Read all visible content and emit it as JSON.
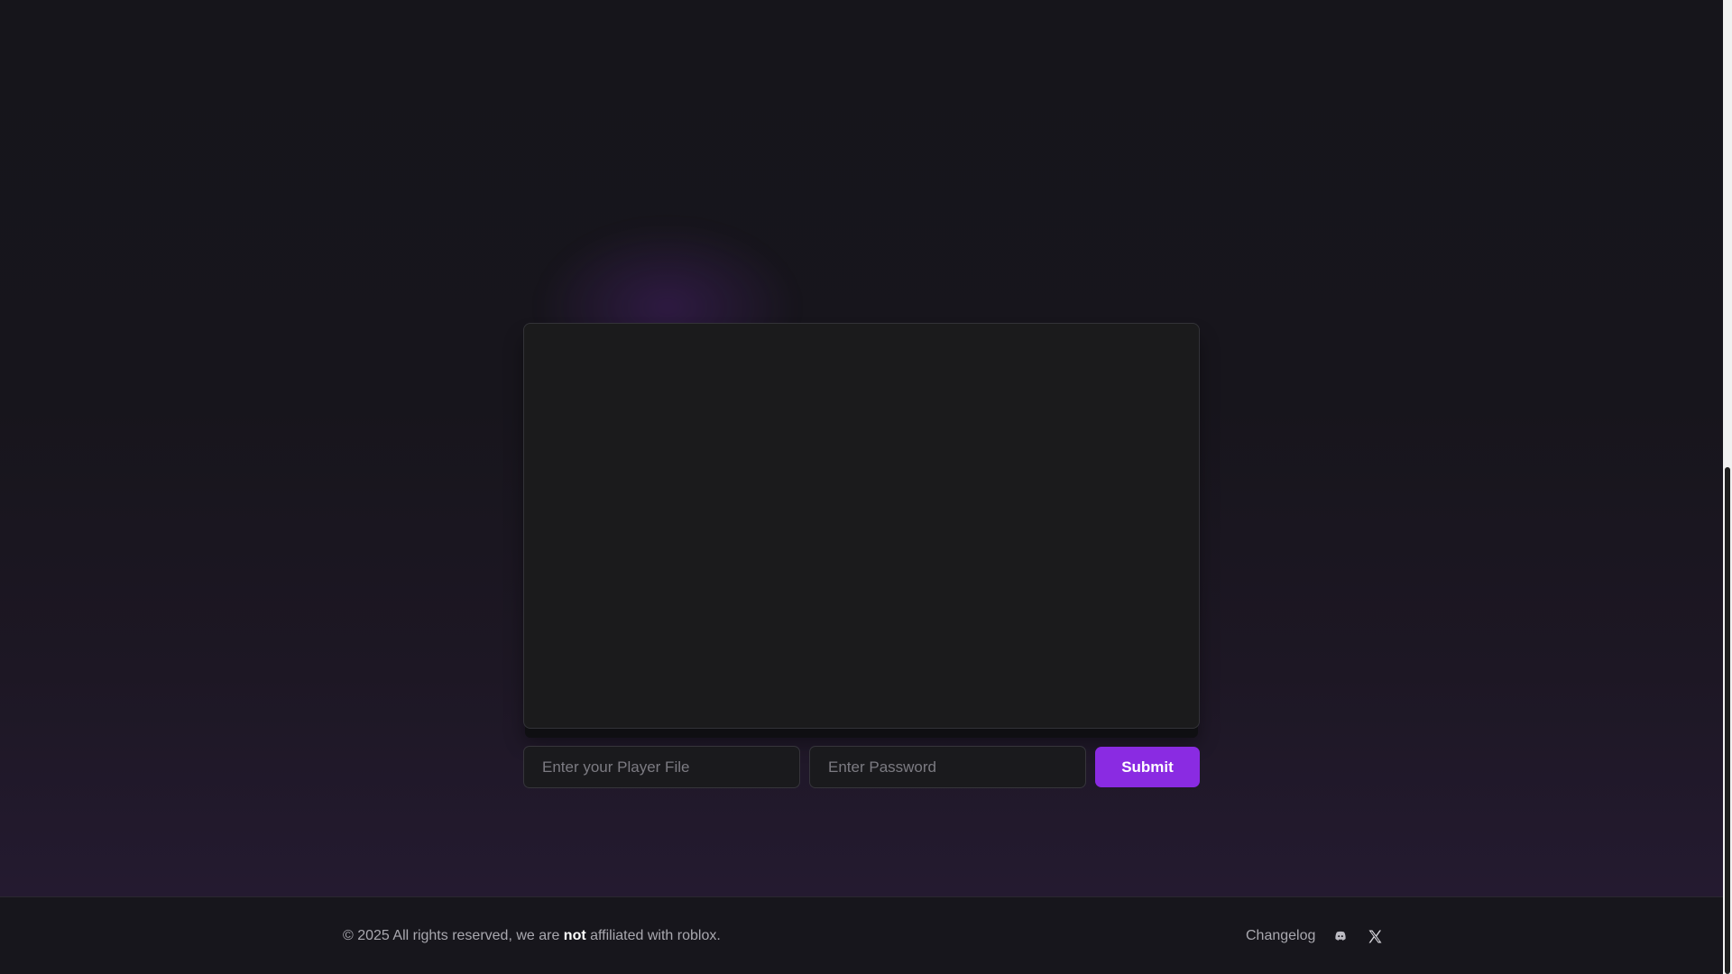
{
  "form": {
    "player_file_placeholder": "Enter your Player File",
    "password_placeholder": "Enter Password",
    "submit_label": "Submit"
  },
  "footer": {
    "copyright_prefix": "© 2025 All rights reserved, we are ",
    "copyright_emphasis": "not",
    "copyright_suffix": " affiliated with roblox.",
    "links": {
      "changelog_label": "Changelog",
      "discord_icon": "discord-icon",
      "x_icon": "x-twitter-icon"
    }
  },
  "colors": {
    "accent": "#8a2be2",
    "background": "#16151b",
    "panel": "#1b1b1c"
  }
}
